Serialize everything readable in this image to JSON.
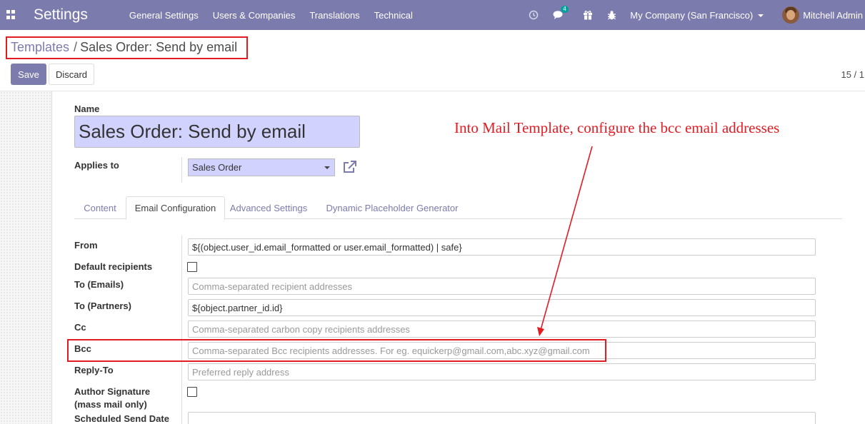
{
  "navbar": {
    "app_title": "Settings",
    "menu": [
      "General Settings",
      "Users & Companies",
      "Translations",
      "Technical"
    ],
    "chat_badge": "4",
    "company": "My Company (San Francisco)",
    "user": "Mitchell Admin"
  },
  "breadcrumb": {
    "parent": "Templates",
    "separator": "/",
    "current": "Sales Order: Send by email"
  },
  "buttons": {
    "save": "Save",
    "discard": "Discard"
  },
  "pager": "15 / 1",
  "form": {
    "name_label": "Name",
    "name_value": "Sales Order: Send by email",
    "applies_to_label": "Applies to",
    "applies_to_value": "Sales Order",
    "tabs": [
      "Content",
      "Email Configuration",
      "Advanced Settings",
      "Dynamic Placeholder Generator"
    ],
    "active_tab": "Email Configuration",
    "fields": {
      "from_label": "From",
      "from_value": "${(object.user_id.email_formatted or user.email_formatted) | safe}",
      "default_recipients_label": "Default recipients",
      "to_emails_label": "To (Emails)",
      "to_emails_placeholder": "Comma-separated recipient addresses",
      "to_partners_label": "To (Partners)",
      "to_partners_value": "${object.partner_id.id}",
      "cc_label": "Cc",
      "cc_placeholder": "Comma-separated carbon copy recipients addresses",
      "bcc_label": "Bcc",
      "bcc_placeholder": "Comma-separated Bcc recipients addresses. For eg. equickerp@gmail.com,abc.xyz@gmail.com",
      "reply_to_label": "Reply-To",
      "reply_to_placeholder": "Preferred reply address",
      "author_signature_label_1": "Author Signature",
      "author_signature_label_2": "(mass mail only)",
      "scheduled_label": "Scheduled Send Date"
    }
  },
  "annotation": {
    "text": "Into Mail Template, configure the bcc email addresses",
    "color": "#e31b23"
  },
  "colors": {
    "navbar": "#7c7bad",
    "accent": "#7c7bad",
    "required_field": "#d2d2ff"
  }
}
